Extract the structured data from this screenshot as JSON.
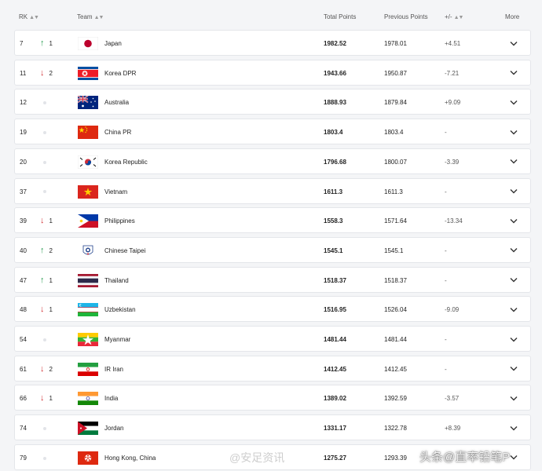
{
  "header": {
    "rk": "RK",
    "team": "Team",
    "total_points": "Total Points",
    "previous_points": "Previous Points",
    "diff": "+/-",
    "more": "More"
  },
  "rows": [
    {
      "rk": "7",
      "move": "up",
      "move_num": "1",
      "team": "Japan",
      "flag": "japan-flag",
      "total": "1982.52",
      "previous": "1978.01",
      "diff": "+4.51"
    },
    {
      "rk": "11",
      "move": "down",
      "move_num": "2",
      "team": "Korea DPR",
      "flag": "korea-dpr-flag",
      "total": "1943.66",
      "previous": "1950.87",
      "diff": "-7.21"
    },
    {
      "rk": "12",
      "move": "none",
      "move_num": "",
      "team": "Australia",
      "flag": "australia-flag",
      "total": "1888.93",
      "previous": "1879.84",
      "diff": "+9.09"
    },
    {
      "rk": "19",
      "move": "none",
      "move_num": "",
      "team": "China PR",
      "flag": "china-flag",
      "total": "1803.4",
      "previous": "1803.4",
      "diff": "-"
    },
    {
      "rk": "20",
      "move": "none",
      "move_num": "",
      "team": "Korea Republic",
      "flag": "korea-republic-flag",
      "total": "1796.68",
      "previous": "1800.07",
      "diff": "-3.39"
    },
    {
      "rk": "37",
      "move": "none",
      "move_num": "",
      "team": "Vietnam",
      "flag": "vietnam-flag",
      "total": "1611.3",
      "previous": "1611.3",
      "diff": "-"
    },
    {
      "rk": "39",
      "move": "down",
      "move_num": "1",
      "team": "Philippines",
      "flag": "philippines-flag",
      "total": "1558.3",
      "previous": "1571.64",
      "diff": "-13.34"
    },
    {
      "rk": "40",
      "move": "up",
      "move_num": "2",
      "team": "Chinese Taipei",
      "flag": "chinese-taipei-flag",
      "total": "1545.1",
      "previous": "1545.1",
      "diff": "-"
    },
    {
      "rk": "47",
      "move": "up",
      "move_num": "1",
      "team": "Thailand",
      "flag": "thailand-flag",
      "total": "1518.37",
      "previous": "1518.37",
      "diff": "-"
    },
    {
      "rk": "48",
      "move": "down",
      "move_num": "1",
      "team": "Uzbekistan",
      "flag": "uzbekistan-flag",
      "total": "1516.95",
      "previous": "1526.04",
      "diff": "-9.09"
    },
    {
      "rk": "54",
      "move": "none",
      "move_num": "",
      "team": "Myanmar",
      "flag": "myanmar-flag",
      "total": "1481.44",
      "previous": "1481.44",
      "diff": "-"
    },
    {
      "rk": "61",
      "move": "down",
      "move_num": "2",
      "team": "IR Iran",
      "flag": "iran-flag",
      "total": "1412.45",
      "previous": "1412.45",
      "diff": "-"
    },
    {
      "rk": "66",
      "move": "down",
      "move_num": "1",
      "team": "India",
      "flag": "india-flag",
      "total": "1389.02",
      "previous": "1392.59",
      "diff": "-3.57"
    },
    {
      "rk": "74",
      "move": "none",
      "move_num": "",
      "team": "Jordan",
      "flag": "jordan-flag",
      "total": "1331.17",
      "previous": "1322.78",
      "diff": "+8.39"
    },
    {
      "rk": "79",
      "move": "none",
      "move_num": "",
      "team": "Hong Kong, China",
      "flag": "hong-kong-flag",
      "total": "1275.27",
      "previous": "1293.39",
      "diff": ""
    }
  ],
  "watermarks": {
    "left": "@安足资讯",
    "right": "头条@直率铅笔P"
  },
  "colors": {
    "up": "#2a9d52",
    "down": "#d3373b",
    "row_background": "#ffffff",
    "page_background": "#f4f5f7"
  }
}
